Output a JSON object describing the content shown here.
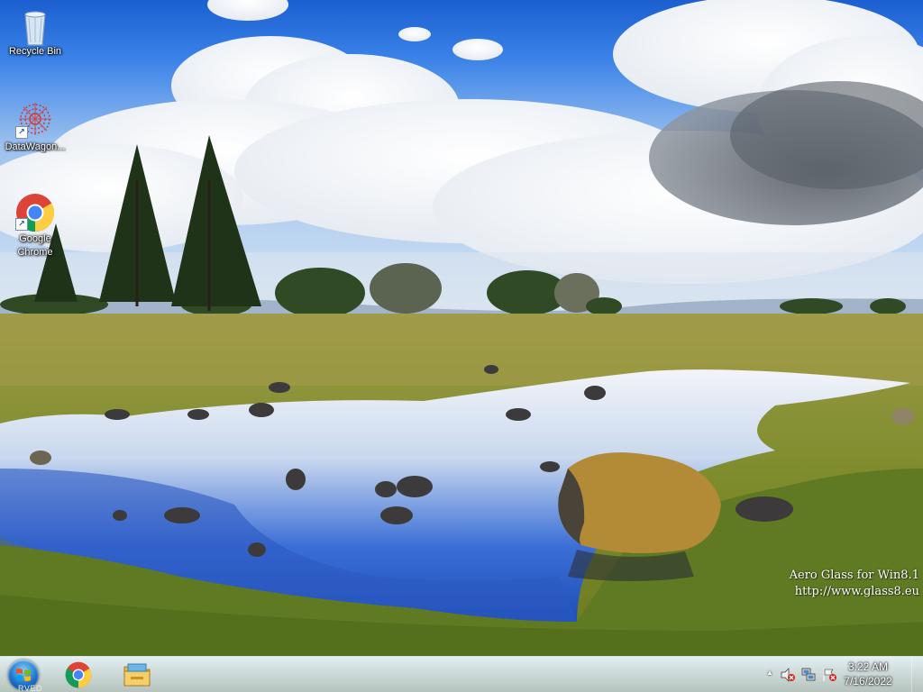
{
  "desktop": {
    "icons": [
      {
        "label": "Recycle Bin",
        "icon": "recycle-bin-icon"
      },
      {
        "label": "DataWagon...",
        "icon": "datawagon-icon"
      },
      {
        "label": "Google Chrome",
        "icon": "chrome-icon"
      }
    ],
    "watermark": {
      "line1": "Aero Glass for Win8.1",
      "line2": "http://www.glass8.eu"
    }
  },
  "taskbar": {
    "start_badge": "RVED",
    "pinned": [
      {
        "name": "Google Chrome",
        "icon": "chrome-icon"
      },
      {
        "name": "File Explorer",
        "icon": "file-explorer-icon"
      }
    ],
    "tray": {
      "chevron": "▲",
      "icons": [
        "speaker-muted-icon",
        "network-icon",
        "action-center-flag-icon"
      ],
      "time": "3:22 AM",
      "date": "7/16/2022"
    }
  },
  "colors": {
    "sky_top": "#1a5fd0",
    "grass": "#7a8a2a",
    "taskbar_tint": "#a0c8d2"
  }
}
